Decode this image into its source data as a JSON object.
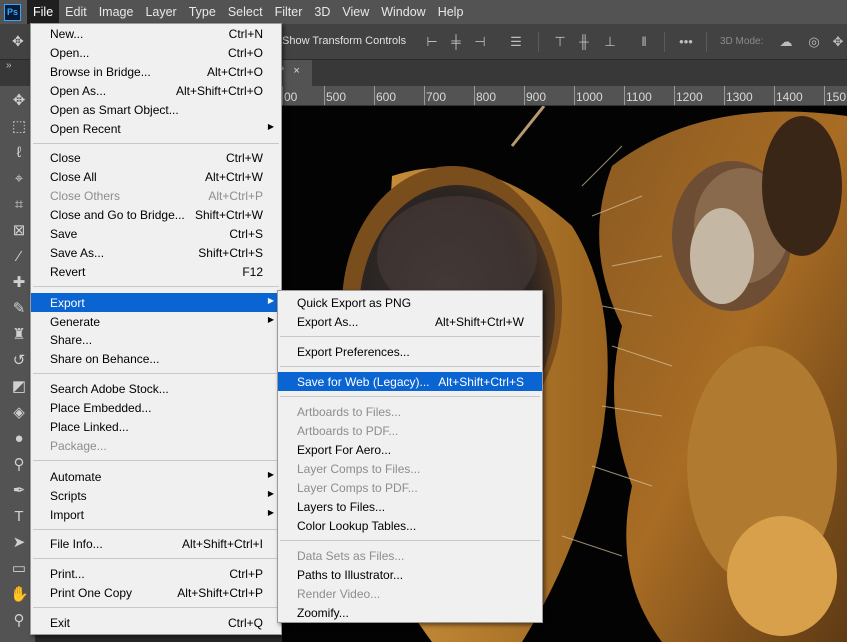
{
  "app": {
    "logo": "Ps"
  },
  "menubar": [
    "File",
    "Edit",
    "Image",
    "Layer",
    "Type",
    "Select",
    "Filter",
    "3D",
    "View",
    "Window",
    "Help"
  ],
  "options": {
    "transform_label": "Show Transform Controls",
    "mode3d_label": "3D Mode:"
  },
  "tab": {
    "title": "*",
    "close": "×"
  },
  "ruler": [
    "00",
    "500",
    "600",
    "700",
    "800",
    "900",
    "1000",
    "1100",
    "1200",
    "1300",
    "1400",
    "150"
  ],
  "file_menu": [
    {
      "label": "New...",
      "shortcut": "Ctrl+N"
    },
    {
      "label": "Open...",
      "shortcut": "Ctrl+O"
    },
    {
      "label": "Browse in Bridge...",
      "shortcut": "Alt+Ctrl+O"
    },
    {
      "label": "Open As...",
      "shortcut": "Alt+Shift+Ctrl+O"
    },
    {
      "label": "Open as Smart Object...",
      "shortcut": ""
    },
    {
      "label": "Open Recent",
      "shortcut": "",
      "submenu": true
    },
    {
      "label": "Close",
      "shortcut": "Ctrl+W"
    },
    {
      "label": "Close All",
      "shortcut": "Alt+Ctrl+W"
    },
    {
      "label": "Close Others",
      "shortcut": "Alt+Ctrl+P",
      "disabled": true
    },
    {
      "label": "Close and Go to Bridge...",
      "shortcut": "Shift+Ctrl+W"
    },
    {
      "label": "Save",
      "shortcut": "Ctrl+S"
    },
    {
      "label": "Save As...",
      "shortcut": "Shift+Ctrl+S"
    },
    {
      "label": "Revert",
      "shortcut": "F12"
    },
    {
      "label": "Export",
      "shortcut": "",
      "submenu": true,
      "highlighted": true
    },
    {
      "label": "Generate",
      "shortcut": "",
      "submenu": true
    },
    {
      "label": "Share...",
      "shortcut": ""
    },
    {
      "label": "Share on Behance...",
      "shortcut": ""
    },
    {
      "label": "Search Adobe Stock...",
      "shortcut": ""
    },
    {
      "label": "Place Embedded...",
      "shortcut": ""
    },
    {
      "label": "Place Linked...",
      "shortcut": ""
    },
    {
      "label": "Package...",
      "shortcut": "",
      "disabled": true
    },
    {
      "label": "Automate",
      "shortcut": "",
      "submenu": true
    },
    {
      "label": "Scripts",
      "shortcut": "",
      "submenu": true
    },
    {
      "label": "Import",
      "shortcut": "",
      "submenu": true
    },
    {
      "label": "File Info...",
      "shortcut": "Alt+Shift+Ctrl+I"
    },
    {
      "label": "Print...",
      "shortcut": "Ctrl+P"
    },
    {
      "label": "Print One Copy",
      "shortcut": "Alt+Shift+Ctrl+P"
    },
    {
      "label": "Exit",
      "shortcut": "Ctrl+Q"
    }
  ],
  "export_menu": [
    {
      "label": "Quick Export as PNG",
      "shortcut": ""
    },
    {
      "label": "Export As...",
      "shortcut": "Alt+Shift+Ctrl+W"
    },
    {
      "label": "Export Preferences...",
      "shortcut": ""
    },
    {
      "label": "Save for Web (Legacy)...",
      "shortcut": "Alt+Shift+Ctrl+S",
      "highlighted": true
    },
    {
      "label": "Artboards to Files...",
      "shortcut": "",
      "disabled": true
    },
    {
      "label": "Artboards to PDF...",
      "shortcut": "",
      "disabled": true
    },
    {
      "label": "Export For Aero...",
      "shortcut": ""
    },
    {
      "label": "Layer Comps to Files...",
      "shortcut": "",
      "disabled": true
    },
    {
      "label": "Layer Comps to PDF...",
      "shortcut": "",
      "disabled": true
    },
    {
      "label": "Layers to Files...",
      "shortcut": ""
    },
    {
      "label": "Color Lookup Tables...",
      "shortcut": ""
    },
    {
      "label": "Data Sets as Files...",
      "shortcut": "",
      "disabled": true
    },
    {
      "label": "Paths to Illustrator...",
      "shortcut": ""
    },
    {
      "label": "Render Video...",
      "shortcut": "",
      "disabled": true
    },
    {
      "label": "Zoomify...",
      "shortcut": ""
    }
  ],
  "colors": {
    "highlight": "#0a64d2",
    "menu_bg": "#f0f0f0",
    "chrome": "#535353"
  }
}
